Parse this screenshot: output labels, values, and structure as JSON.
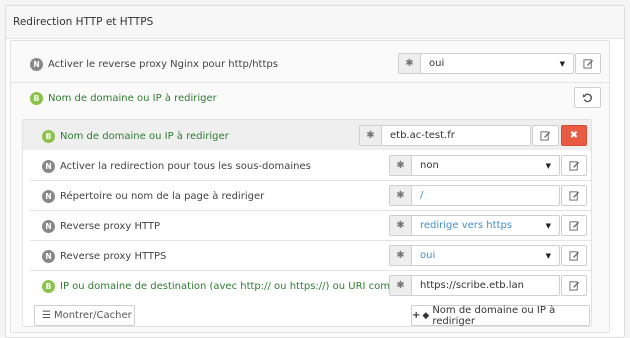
{
  "panel": {
    "title": "Redirection HTTP et HTTPS"
  },
  "row_activate": {
    "badge": "N",
    "label": "Activer le reverse proxy Nginx pour http/https",
    "value": "oui"
  },
  "group": {
    "badge": "B",
    "label": "Nom de domaine ou IP à rediriger"
  },
  "inner": {
    "domain": {
      "badge": "B",
      "label": "Nom de domaine ou IP à rediriger",
      "value": "etb.ac-test.fr"
    },
    "subdomains": {
      "badge": "N",
      "label": "Activer la redirection pour tous les sous-domaines",
      "value": "non"
    },
    "page": {
      "badge": "N",
      "label": "Répertoire ou nom de la page à rediriger",
      "value": "/"
    },
    "proxy_http": {
      "badge": "N",
      "label": "Reverse proxy HTTP",
      "value": "redirige vers https"
    },
    "proxy_https": {
      "badge": "N",
      "label": "Reverse proxy HTTPS",
      "value": "oui"
    },
    "destination": {
      "badge": "B",
      "label": "IP ou domaine de destination (avec http:// ou https://) ou URI complète",
      "value": "https://scribe.etb.lan"
    }
  },
  "footer": {
    "toggle_label": "Montrer/Cacher",
    "add_label": "Nom de domaine ou IP à rediriger"
  },
  "icons": {
    "addon": "asterisk-icon",
    "edit": "edit-icon",
    "delete": "close-icon",
    "reset": "undo-icon",
    "list": "list-icon",
    "add": "plus-icon",
    "tag": "tag-icon"
  },
  "colors": {
    "green": "#8bc34a",
    "red": "#e85c41",
    "link_blue": "#3f8fd0"
  }
}
